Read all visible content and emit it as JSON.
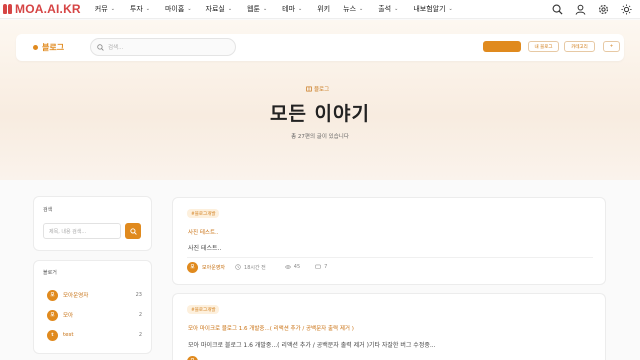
{
  "site": {
    "logo": "MOA.AI.KR"
  },
  "nav": {
    "items": [
      {
        "label": "커뮤"
      },
      {
        "label": "투자"
      },
      {
        "label": "마이홈"
      },
      {
        "label": "자료실"
      },
      {
        "label": "웹툰"
      },
      {
        "label": "테마"
      },
      {
        "label": "위키"
      },
      {
        "label": "뉴스"
      },
      {
        "label": "출석"
      },
      {
        "label": "내보험알기"
      }
    ],
    "chevron": "⌄"
  },
  "subbar": {
    "blog_label": "블로그",
    "search_placeholder": "검색...",
    "my_blog": "내 블로그",
    "category": "카테고리",
    "plus": "+"
  },
  "hero": {
    "badge": "블로그",
    "title": "모든 이야기",
    "subtitle": "총 27편의 글이 있습니다"
  },
  "sidebar": {
    "search": {
      "title": "검색",
      "placeholder": "제목, 내용 검색..."
    },
    "bloggers": {
      "title": "블로거",
      "items": [
        {
          "initial": "모",
          "name": "모아운영자",
          "count": "23"
        },
        {
          "initial": "모",
          "name": "모아",
          "count": "2"
        },
        {
          "initial": "t",
          "name": "test",
          "count": "2"
        }
      ]
    }
  },
  "posts": [
    {
      "tag": "#블로그개발",
      "title": "사진 테스트..",
      "body": "사진 테스트..",
      "author_initial": "모",
      "author": "모아운영자",
      "time": "18시간 전",
      "views": "45",
      "comments": "7"
    },
    {
      "tag": "#블로그개발",
      "title": "모아 마이크로 블로그 1.6 개발중...( 리액션 추가 / 공백문자 출력 제거 )",
      "body": "모아 마이크로 블로그 1.6 개발중...( 리액션 추가 / 공백문자 출력 제거 )기타 자잘한 버그 수정중...",
      "author_initial": "모"
    }
  ],
  "colors": {
    "accent": "#e08a1e",
    "logo": "#d64545"
  }
}
